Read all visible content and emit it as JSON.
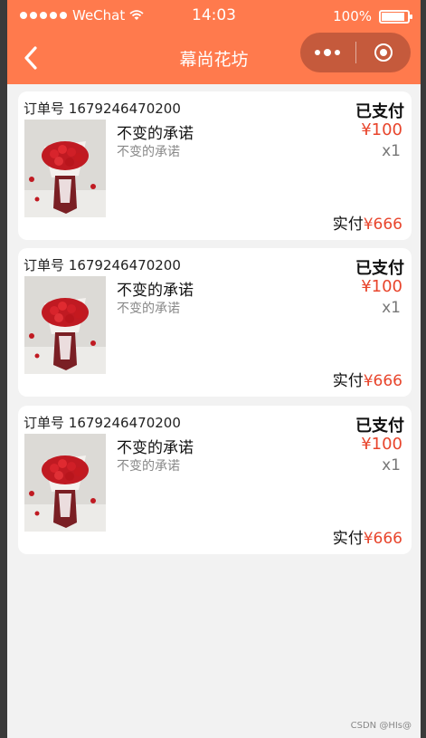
{
  "status_bar": {
    "carrier": "WeChat",
    "time": "14:03",
    "battery": "100%"
  },
  "nav": {
    "title": "幕尚花坊"
  },
  "labels": {
    "order_prefix": "订单号",
    "actual_paid": "实付"
  },
  "orders": [
    {
      "order_no": "1679246470200",
      "status": "已支付",
      "product_name": "不变的承诺",
      "product_desc": "不变的承诺",
      "price": "¥100",
      "quantity": "x1",
      "total": "¥666"
    },
    {
      "order_no": "1679246470200",
      "status": "已支付",
      "product_name": "不变的承诺",
      "product_desc": "不变的承诺",
      "price": "¥100",
      "quantity": "x1",
      "total": "¥666"
    },
    {
      "order_no": "1679246470200",
      "status": "已支付",
      "product_name": "不变的承诺",
      "product_desc": "不变的承诺",
      "price": "¥100",
      "quantity": "x1",
      "total": "¥666"
    }
  ],
  "watermark": "CSDN @HIs@",
  "colors": {
    "header": "#ff7a4d",
    "price": "#e8452c",
    "background": "#f2f2f2"
  }
}
